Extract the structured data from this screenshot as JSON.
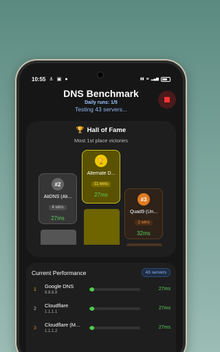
{
  "status_bar": {
    "time": "10:55",
    "battery_level": 0.7
  },
  "header": {
    "title": "DNS Benchmark",
    "daily_runs": "Daily runs: 1/5",
    "testing": "Testing 43 servers..."
  },
  "hall_of_fame": {
    "title": "Hall of Fame",
    "subtitle": "Most 1st place victories",
    "cards": [
      {
        "rank": "#2",
        "name": "AliDNS (Ali...",
        "wins": "4 wins",
        "ms": "27ms"
      },
      {
        "rank": "",
        "name": "Alternate D...",
        "wins": "11 wins",
        "ms": "27ms"
      },
      {
        "rank": "#3",
        "name": "Quad9 (Un...",
        "wins": "2 wins",
        "ms": "32ms"
      }
    ]
  },
  "performance": {
    "title": "Current Performance",
    "servers_badge": "43 servers",
    "rows": [
      {
        "rank": "1",
        "name": "Google DNS",
        "ip": "8.8.8.8",
        "ms": "27ms",
        "rank_color": "#e0b020",
        "fill": 0.05
      },
      {
        "rank": "2",
        "name": "Cloudflare",
        "ip": "1.1.1.1",
        "ms": "27ms",
        "rank_color": "#bbbbbb",
        "fill": 0.05
      },
      {
        "rank": "3",
        "name": "Cloudflare (M...",
        "ip": "1.1.1.2",
        "ms": "27ms",
        "rank_color": "#e07a20",
        "fill": 0.05
      }
    ]
  }
}
